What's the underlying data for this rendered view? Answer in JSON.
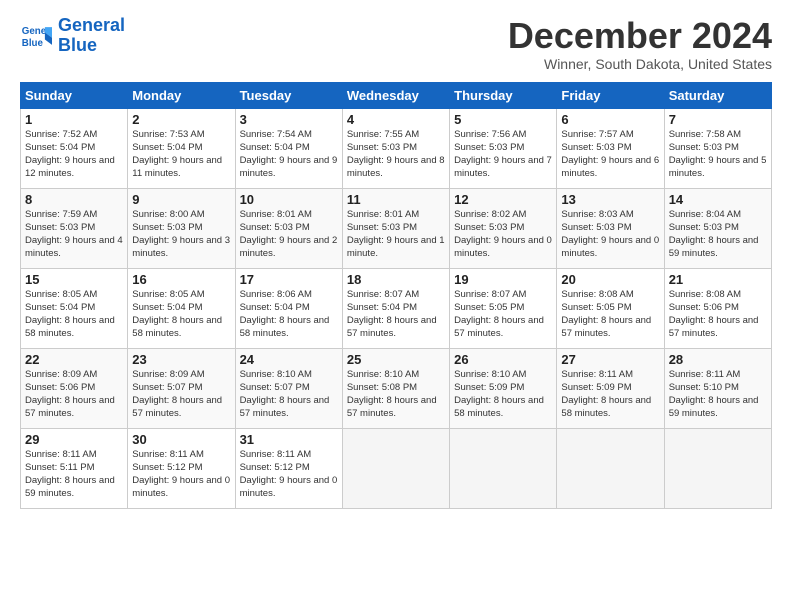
{
  "logo": {
    "line1": "General",
    "line2": "Blue"
  },
  "title": "December 2024",
  "location": "Winner, South Dakota, United States",
  "days_of_week": [
    "Sunday",
    "Monday",
    "Tuesday",
    "Wednesday",
    "Thursday",
    "Friday",
    "Saturday"
  ],
  "weeks": [
    [
      {
        "num": "1",
        "rise": "7:52 AM",
        "set": "5:04 PM",
        "daylight": "9 hours and 12 minutes."
      },
      {
        "num": "2",
        "rise": "7:53 AM",
        "set": "5:04 PM",
        "daylight": "9 hours and 11 minutes."
      },
      {
        "num": "3",
        "rise": "7:54 AM",
        "set": "5:04 PM",
        "daylight": "9 hours and 9 minutes."
      },
      {
        "num": "4",
        "rise": "7:55 AM",
        "set": "5:03 PM",
        "daylight": "9 hours and 8 minutes."
      },
      {
        "num": "5",
        "rise": "7:56 AM",
        "set": "5:03 PM",
        "daylight": "9 hours and 7 minutes."
      },
      {
        "num": "6",
        "rise": "7:57 AM",
        "set": "5:03 PM",
        "daylight": "9 hours and 6 minutes."
      },
      {
        "num": "7",
        "rise": "7:58 AM",
        "set": "5:03 PM",
        "daylight": "9 hours and 5 minutes."
      }
    ],
    [
      {
        "num": "8",
        "rise": "7:59 AM",
        "set": "5:03 PM",
        "daylight": "9 hours and 4 minutes."
      },
      {
        "num": "9",
        "rise": "8:00 AM",
        "set": "5:03 PM",
        "daylight": "9 hours and 3 minutes."
      },
      {
        "num": "10",
        "rise": "8:01 AM",
        "set": "5:03 PM",
        "daylight": "9 hours and 2 minutes."
      },
      {
        "num": "11",
        "rise": "8:01 AM",
        "set": "5:03 PM",
        "daylight": "9 hours and 1 minute."
      },
      {
        "num": "12",
        "rise": "8:02 AM",
        "set": "5:03 PM",
        "daylight": "9 hours and 0 minutes."
      },
      {
        "num": "13",
        "rise": "8:03 AM",
        "set": "5:03 PM",
        "daylight": "9 hours and 0 minutes."
      },
      {
        "num": "14",
        "rise": "8:04 AM",
        "set": "5:03 PM",
        "daylight": "8 hours and 59 minutes."
      }
    ],
    [
      {
        "num": "15",
        "rise": "8:05 AM",
        "set": "5:04 PM",
        "daylight": "8 hours and 58 minutes."
      },
      {
        "num": "16",
        "rise": "8:05 AM",
        "set": "5:04 PM",
        "daylight": "8 hours and 58 minutes."
      },
      {
        "num": "17",
        "rise": "8:06 AM",
        "set": "5:04 PM",
        "daylight": "8 hours and 58 minutes."
      },
      {
        "num": "18",
        "rise": "8:07 AM",
        "set": "5:04 PM",
        "daylight": "8 hours and 57 minutes."
      },
      {
        "num": "19",
        "rise": "8:07 AM",
        "set": "5:05 PM",
        "daylight": "8 hours and 57 minutes."
      },
      {
        "num": "20",
        "rise": "8:08 AM",
        "set": "5:05 PM",
        "daylight": "8 hours and 57 minutes."
      },
      {
        "num": "21",
        "rise": "8:08 AM",
        "set": "5:06 PM",
        "daylight": "8 hours and 57 minutes."
      }
    ],
    [
      {
        "num": "22",
        "rise": "8:09 AM",
        "set": "5:06 PM",
        "daylight": "8 hours and 57 minutes."
      },
      {
        "num": "23",
        "rise": "8:09 AM",
        "set": "5:07 PM",
        "daylight": "8 hours and 57 minutes."
      },
      {
        "num": "24",
        "rise": "8:10 AM",
        "set": "5:07 PM",
        "daylight": "8 hours and 57 minutes."
      },
      {
        "num": "25",
        "rise": "8:10 AM",
        "set": "5:08 PM",
        "daylight": "8 hours and 57 minutes."
      },
      {
        "num": "26",
        "rise": "8:10 AM",
        "set": "5:09 PM",
        "daylight": "8 hours and 58 minutes."
      },
      {
        "num": "27",
        "rise": "8:11 AM",
        "set": "5:09 PM",
        "daylight": "8 hours and 58 minutes."
      },
      {
        "num": "28",
        "rise": "8:11 AM",
        "set": "5:10 PM",
        "daylight": "8 hours and 59 minutes."
      }
    ],
    [
      {
        "num": "29",
        "rise": "8:11 AM",
        "set": "5:11 PM",
        "daylight": "8 hours and 59 minutes."
      },
      {
        "num": "30",
        "rise": "8:11 AM",
        "set": "5:12 PM",
        "daylight": "9 hours and 0 minutes."
      },
      {
        "num": "31",
        "rise": "8:11 AM",
        "set": "5:12 PM",
        "daylight": "9 hours and 0 minutes."
      },
      null,
      null,
      null,
      null
    ]
  ]
}
